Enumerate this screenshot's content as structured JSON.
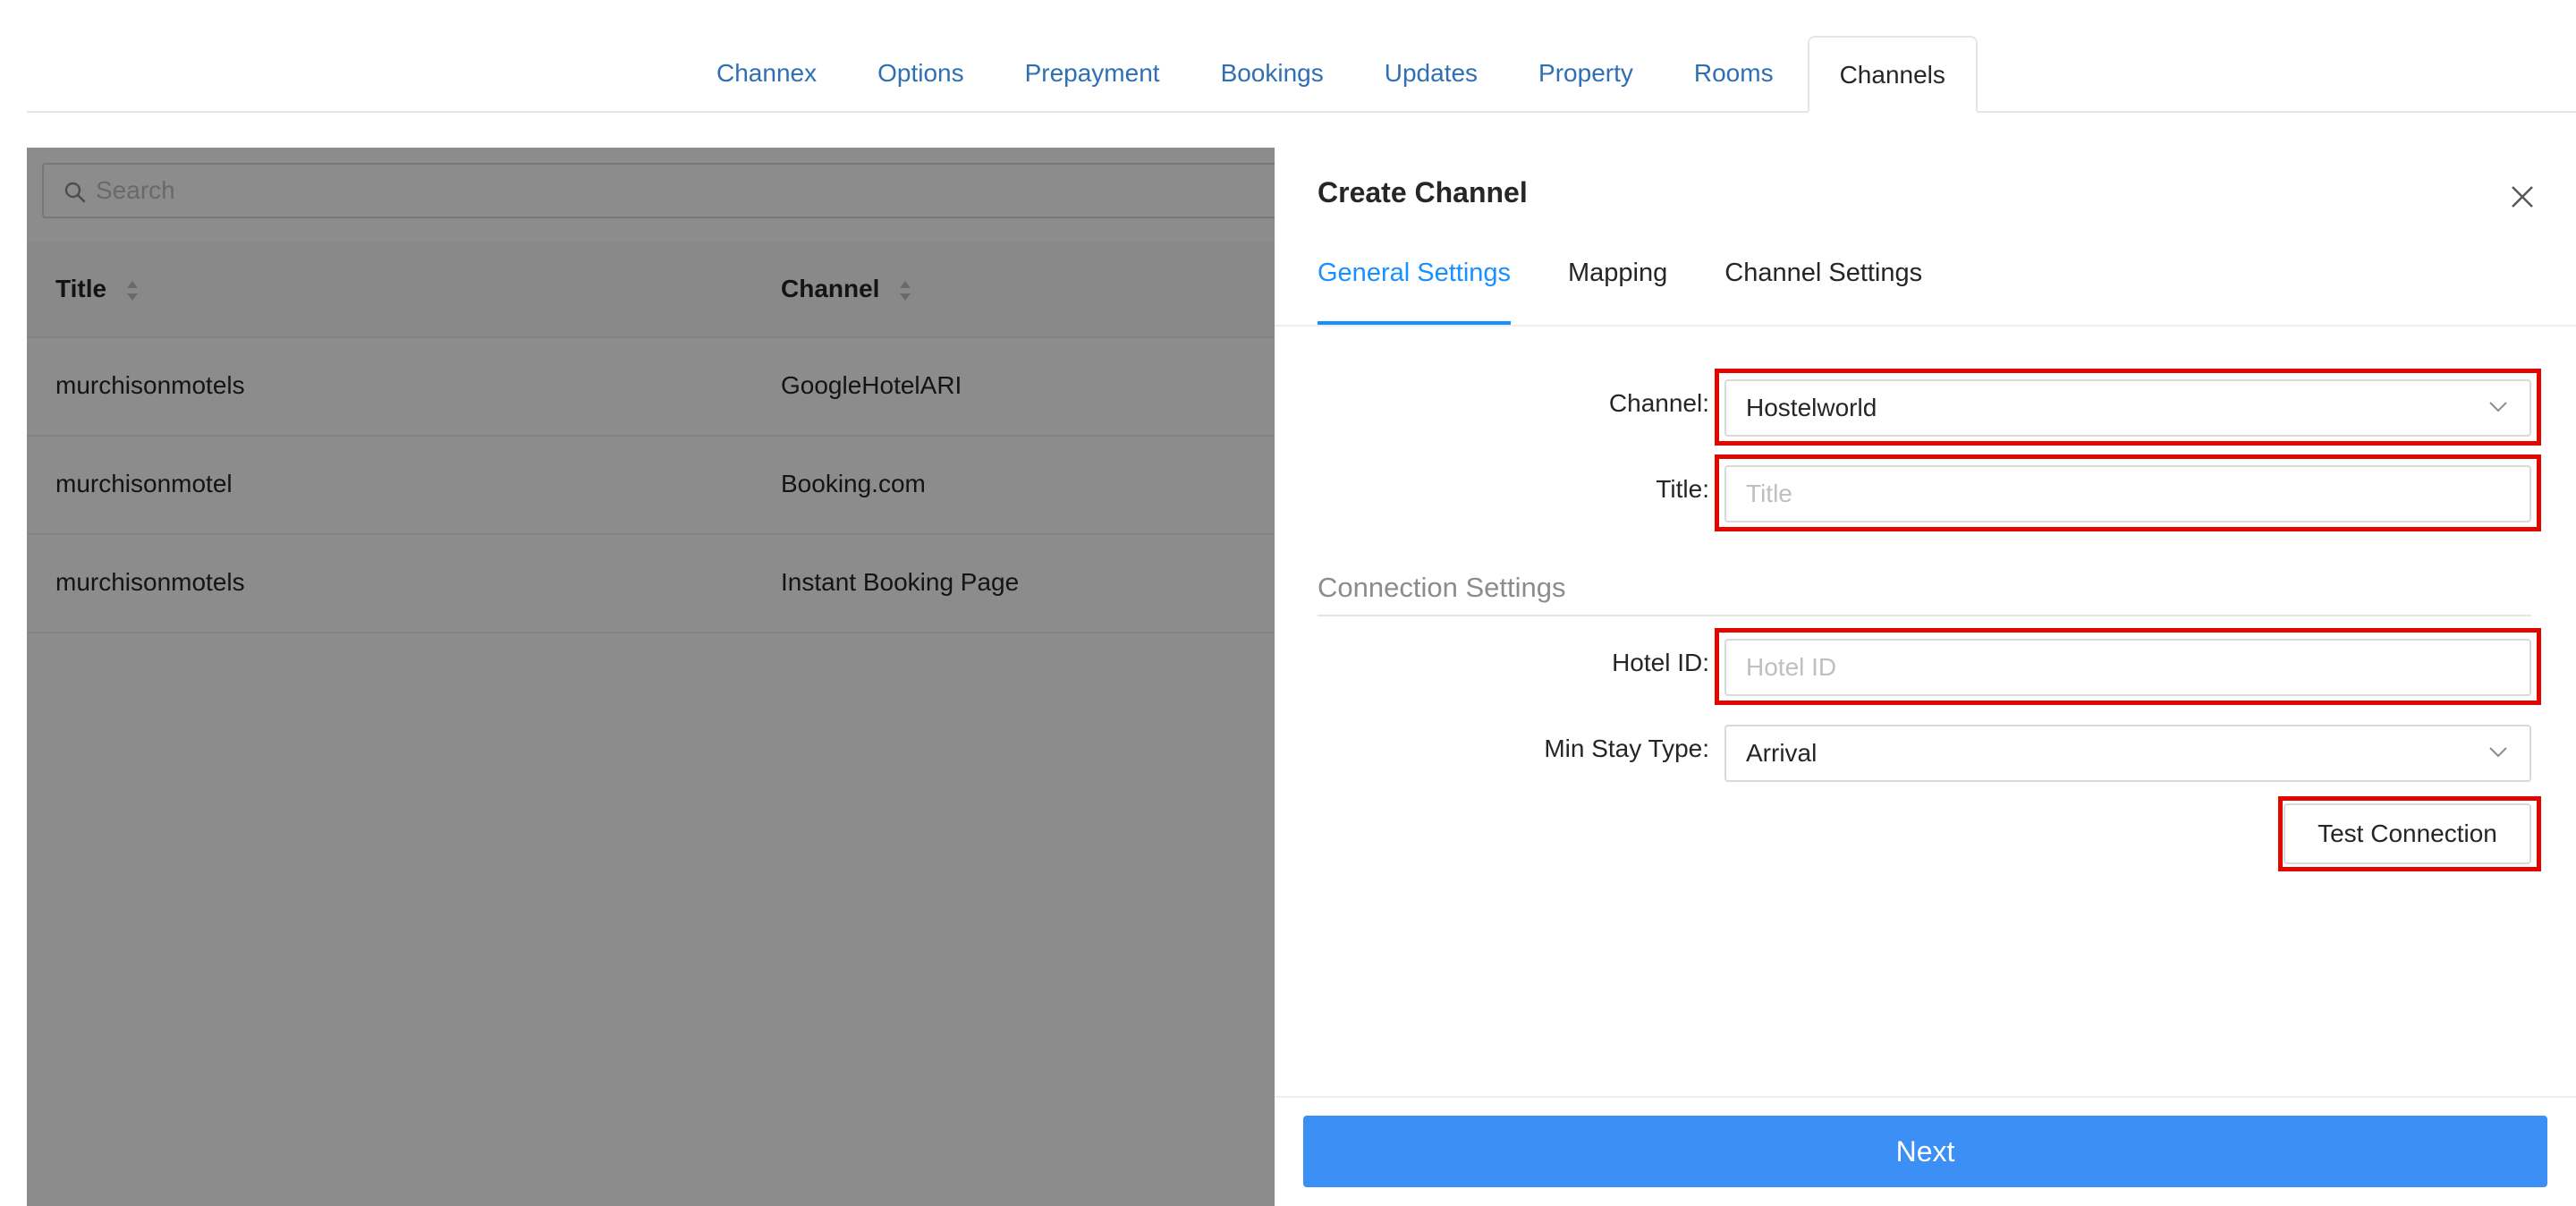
{
  "top_tabs": [
    {
      "label": "Channex"
    },
    {
      "label": "Options"
    },
    {
      "label": "Prepayment"
    },
    {
      "label": "Bookings"
    },
    {
      "label": "Updates"
    },
    {
      "label": "Property"
    },
    {
      "label": "Rooms"
    },
    {
      "label": "Channels",
      "active": true
    }
  ],
  "list": {
    "search_placeholder": "Search",
    "columns": [
      "Title",
      "Channel"
    ],
    "rows": [
      {
        "title": "murchisonmotels",
        "channel": "GoogleHotelARI"
      },
      {
        "title": "murchisonmotel",
        "channel": "Booking.com"
      },
      {
        "title": "murchisonmotels",
        "channel": "Instant Booking Page"
      }
    ]
  },
  "drawer": {
    "title": "Create Channel",
    "tabs": [
      "General Settings",
      "Mapping",
      "Channel Settings"
    ],
    "active_tab": "General Settings",
    "form": {
      "channel_label": "Channel",
      "channel_value": "Hostelworld",
      "title_label": "Title",
      "title_placeholder": "Title",
      "section_title": "Connection Settings",
      "hotel_id_label": "Hotel ID",
      "hotel_id_placeholder": "Hotel ID",
      "min_stay_label": "Min Stay Type",
      "min_stay_value": "Arrival",
      "test_connection_label": "Test Connection"
    },
    "next_label": "Next"
  },
  "colors": {
    "accent": "#1890ff",
    "primary_button": "#3b8ff5",
    "link": "#2f6fb3",
    "highlight": "#e10600"
  },
  "icons": [
    "search-icon",
    "sort-icon",
    "close-icon",
    "chevron-down-icon"
  ]
}
